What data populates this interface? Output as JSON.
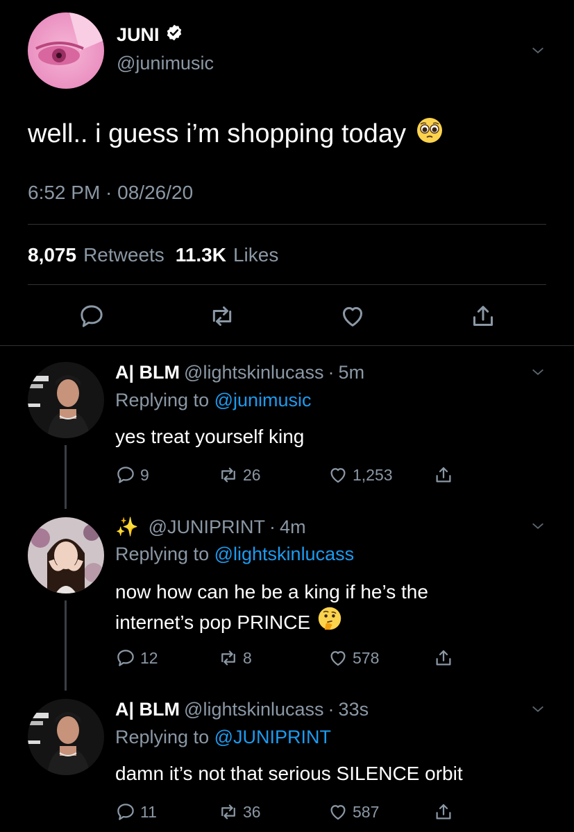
{
  "main_tweet": {
    "display_name": "JUNI",
    "handle": "@junimusic",
    "text": "well.. i guess i’m shopping today",
    "timestamp": "6:52 PM · 08/26/20",
    "retweets_count": "8,075",
    "retweets_label": "Retweets",
    "likes_count": "11.3K",
    "likes_label": "Likes",
    "emoji": "pleading-face-emoji",
    "verified_icon": "verified-badge-icon"
  },
  "replies": [
    {
      "display_name": "A| BLM",
      "handle": "@lightskinlucass",
      "time": "5m",
      "replying_label": "Replying to",
      "replying_to": "@junimusic",
      "text": "yes treat yourself king",
      "reply_count": "9",
      "retweet_count": "26",
      "like_count": "1,253"
    },
    {
      "display_name": "✨",
      "handle": "@JUNIPRINT",
      "time": "4m",
      "replying_label": "Replying to",
      "replying_to": "@lightskinlucass",
      "text_line1": "now how can he be a king if he’s the",
      "text_line2": "internet’s pop PRINCE",
      "emoji": "thinking-face-emoji",
      "reply_count": "12",
      "retweet_count": "8",
      "like_count": "578"
    },
    {
      "display_name": "A| BLM",
      "handle": "@lightskinlucass",
      "time": "33s",
      "replying_label": "Replying to",
      "replying_to": "@JUNIPRINT",
      "text": "damn it’s not that serious SILENCE orbit",
      "reply_count": "11",
      "retweet_count": "36",
      "like_count": "587"
    }
  ],
  "colors": {
    "background": "#000000",
    "text": "#e7e9ea",
    "muted": "#8b98a5",
    "link": "#1d9bf0",
    "divider": "#2f3336"
  }
}
